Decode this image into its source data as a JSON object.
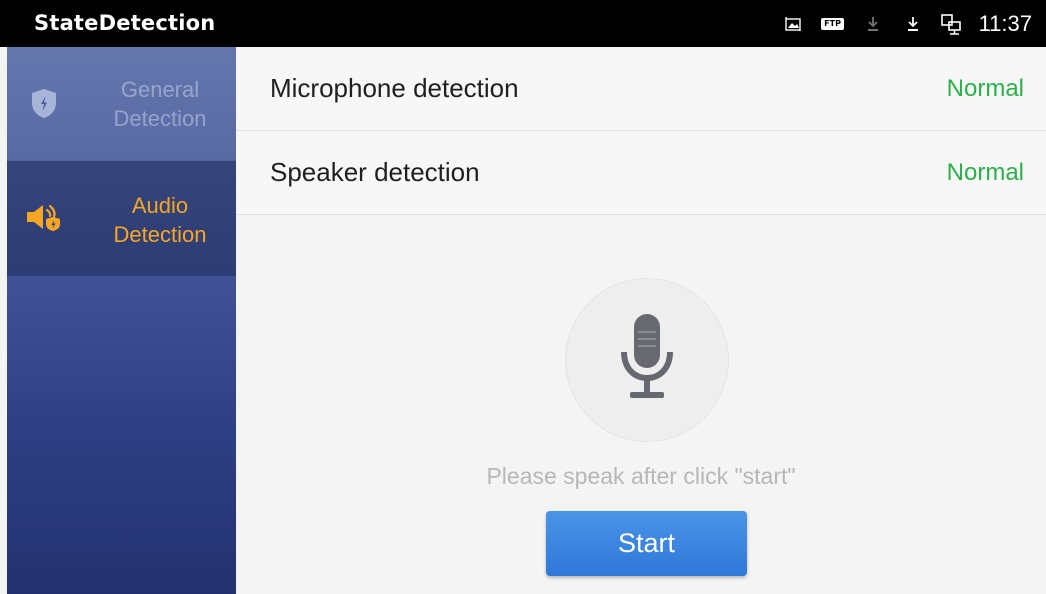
{
  "status_bar": {
    "app_title": "StateDetection",
    "icons": [
      "screenshot-icon",
      "ftp-icon",
      "download-icon",
      "download-icon",
      "ethernet-icon"
    ],
    "ftp_label": "FTP",
    "time": "11:37"
  },
  "sidebar": {
    "items": [
      {
        "label_line1": "General",
        "label_line2": "Detection",
        "icon": "shield-icon",
        "active": false
      },
      {
        "label_line1": "Audio",
        "label_line2": "Detection",
        "icon": "speaker-icon",
        "active": true
      }
    ]
  },
  "main": {
    "rows": [
      {
        "label": "Microphone detection",
        "status": "Normal"
      },
      {
        "label": "Speaker detection",
        "status": "Normal"
      }
    ],
    "mic_icon": "microphone-icon",
    "hint": "Please speak after click \"start\"",
    "start_label": "Start"
  },
  "colors": {
    "accent": "#f5a623",
    "status_ok": "#2bb04a",
    "button": "#3a86e0",
    "sidebar_top": "#5b6fa8",
    "sidebar_bottom": "#23316f"
  }
}
